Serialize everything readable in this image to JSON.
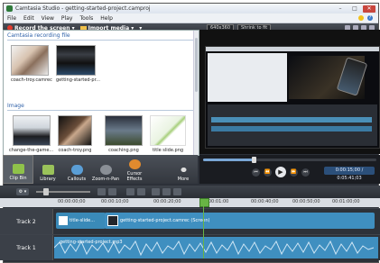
{
  "window": {
    "title": "Camtasia Studio - getting-started-project.camproj",
    "min": "–",
    "max": "□",
    "close": "✕"
  },
  "menu": [
    "File",
    "Edit",
    "View",
    "Play",
    "Tools",
    "Help"
  ],
  "toolbar": {
    "record": "Record the screen",
    "import": "Import media",
    "extra": "▾"
  },
  "preview_toolbar": {
    "size": "640x360",
    "zoom": "Shrink to fit"
  },
  "bin": {
    "section_recording": "Camtasia recording file",
    "recording_items": [
      {
        "caption": "coach-troy.camrec"
      },
      {
        "caption": "getting-started-pr..."
      }
    ],
    "section_image": "Image",
    "image_items": [
      {
        "caption": "change-the-game..."
      },
      {
        "caption": "coach-troy.png"
      },
      {
        "caption": "coaching.png"
      },
      {
        "caption": "title slide.png"
      }
    ]
  },
  "tabs": [
    {
      "label": "Clip Bin",
      "icon": "film-icon",
      "color": "#8fc24a"
    },
    {
      "label": "Library",
      "icon": "library-icon",
      "color": "#9ac25a"
    },
    {
      "label": "Callouts",
      "icon": "callout-icon",
      "color": "#5a9ed6"
    },
    {
      "label": "Zoom-n-Pan",
      "icon": "zoom-icon",
      "color": "#8a8f96"
    },
    {
      "label": "Cursor Effects",
      "icon": "cursor-effects-icon",
      "color": "#e08a2e"
    },
    {
      "label": "More",
      "icon": "more-icon",
      "color": "#cccccc"
    }
  ],
  "playback": {
    "time": "0:00:15;00 / 0:05:41;03",
    "prev": "⏮",
    "back": "⏪",
    "play": "▶",
    "fwd": "⏩",
    "next": "⏭"
  },
  "timeline": {
    "gear": "⚙ ▾",
    "ruler": [
      "00:00:00;00",
      "00:00:10;00",
      "00:00:20;00",
      "0:00:01:00",
      "00:00:40;00",
      "00:00:50;00",
      "00:01:00;00"
    ],
    "tracks": [
      {
        "label": "Track 2",
        "clips": [
          {
            "text": "title-slide..."
          },
          {
            "text": "getting-started-project.camrec (Screen)"
          }
        ]
      },
      {
        "label": "Track 1",
        "clips": [
          {
            "text": "getting-started-project.mp3"
          }
        ]
      }
    ]
  },
  "colors": {
    "accent": "#2f61a8",
    "playhead": "#68b444",
    "clip_blue": "#3f8fc0"
  }
}
